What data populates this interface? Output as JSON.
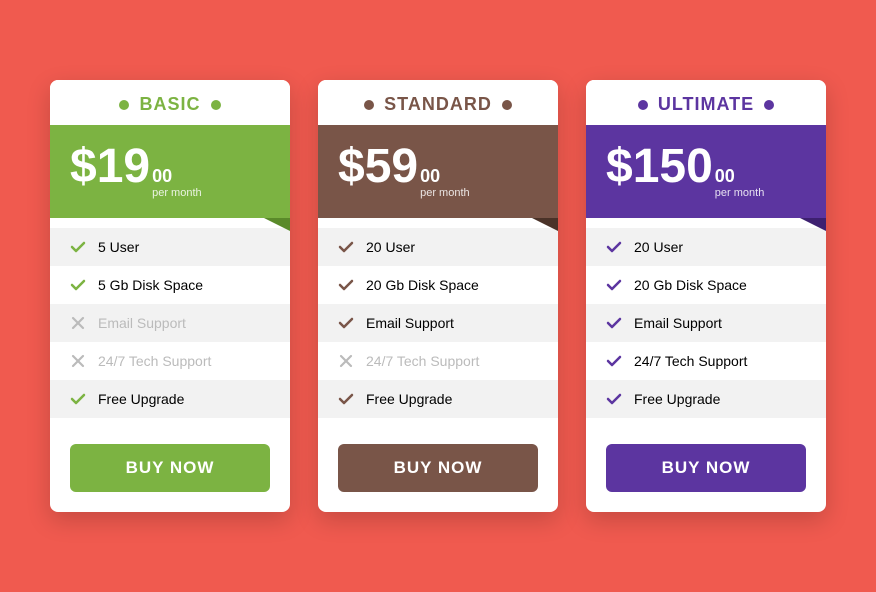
{
  "plans": [
    {
      "id": "basic",
      "name": "BASIC",
      "price": "$19",
      "cents": "00",
      "period": "per month",
      "color": "#7cb342",
      "button_label": "BUY NOW",
      "features": [
        {
          "label": "5 User",
          "enabled": true
        },
        {
          "label": "5 Gb Disk Space",
          "enabled": true
        },
        {
          "label": "Email Support",
          "enabled": false
        },
        {
          "label": "24/7 Tech Support",
          "enabled": false
        },
        {
          "label": "Free Upgrade",
          "enabled": true
        }
      ]
    },
    {
      "id": "standard",
      "name": "STANDARD",
      "price": "$59",
      "cents": "00",
      "period": "per month",
      "color": "#795548",
      "button_label": "BUY NOW",
      "features": [
        {
          "label": "20 User",
          "enabled": true
        },
        {
          "label": "20 Gb Disk Space",
          "enabled": true
        },
        {
          "label": "Email Support",
          "enabled": true
        },
        {
          "label": "24/7 Tech Support",
          "enabled": false
        },
        {
          "label": "Free Upgrade",
          "enabled": true
        }
      ]
    },
    {
      "id": "ultimate",
      "name": "ULTIMATE",
      "price": "$150",
      "cents": "00",
      "period": "per month",
      "color": "#5c35a0",
      "button_label": "BUY NOW",
      "features": [
        {
          "label": "20 User",
          "enabled": true
        },
        {
          "label": "20 Gb Disk Space",
          "enabled": true
        },
        {
          "label": "Email Support",
          "enabled": true
        },
        {
          "label": "24/7 Tech Support",
          "enabled": true
        },
        {
          "label": "Free Upgrade",
          "enabled": true
        }
      ]
    }
  ]
}
